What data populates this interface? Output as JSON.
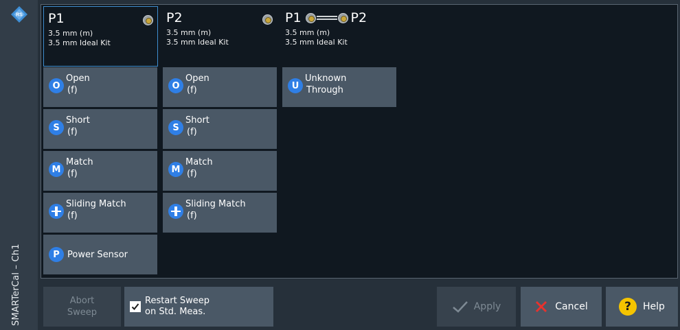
{
  "sidebar": {
    "title": "SMARTerCal – Ch1",
    "logo_icon": "rohde-schwarz-logo"
  },
  "ports": [
    {
      "name": "P1",
      "connector": "3.5 mm (m)",
      "kit": "3.5 mm Ideal Kit"
    },
    {
      "name": "P2",
      "connector": "3.5 mm (m)",
      "kit": "3.5 mm Ideal Kit"
    },
    {
      "name_a": "P1",
      "name_b": "P2",
      "connector": "3.5 mm (m)",
      "kit": "3.5 mm Ideal Kit"
    }
  ],
  "p1_standards": [
    {
      "icon": "O",
      "label": "Open",
      "sub": "(f)"
    },
    {
      "icon": "S",
      "label": "Short",
      "sub": "(f)"
    },
    {
      "icon": "M",
      "label": "Match",
      "sub": "(f)"
    },
    {
      "icon": "sliding-match-icon",
      "label": "Sliding Match",
      "sub": "(f)"
    },
    {
      "icon": "P",
      "label": "Power Sensor"
    }
  ],
  "p2_standards": [
    {
      "icon": "O",
      "label": "Open",
      "sub": "(f)"
    },
    {
      "icon": "S",
      "label": "Short",
      "sub": "(f)"
    },
    {
      "icon": "M",
      "label": "Match",
      "sub": "(f)"
    },
    {
      "icon": "sliding-match-icon",
      "label": "Sliding Match",
      "sub": "(f)"
    }
  ],
  "through_standard": {
    "icon": "U",
    "label": "Unknown",
    "sub": "Through"
  },
  "bottom": {
    "abort_line1": "Abort",
    "abort_line2": "Sweep",
    "restart_line1": "Restart Sweep",
    "restart_line2": "on Std. Meas.",
    "restart_checked": true,
    "apply": "Apply",
    "cancel": "Cancel",
    "help": "Help"
  },
  "colors": {
    "accent": "#2f7fe6",
    "button": "#4a5866",
    "panel": "#101820",
    "selection": "#3f8ecf",
    "cancel_x": "#e8322d",
    "help": "#f5c400"
  }
}
